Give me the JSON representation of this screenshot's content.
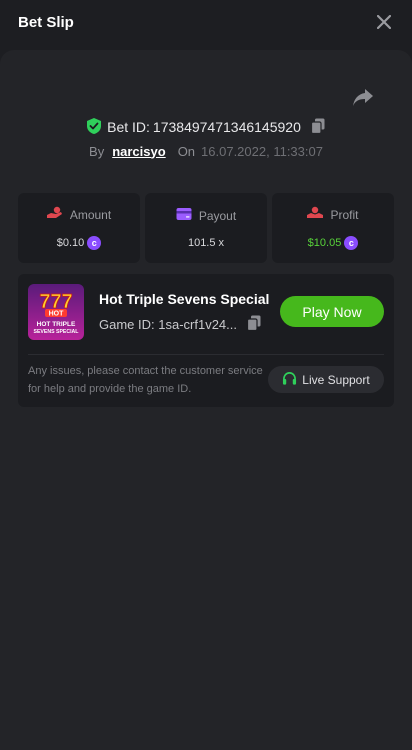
{
  "header": {
    "title": "Bet Slip",
    "close_icon": "close-icon"
  },
  "bet": {
    "id_label": "Bet ID:",
    "id_value": "1738497471346145920",
    "by_label": "By",
    "username": "narcisyo",
    "on_label": "On",
    "datetime": "16.07.2022, 11:33:07"
  },
  "stats": [
    {
      "label": "Amount",
      "value": "$0.10",
      "icon": "amount-hand-icon",
      "coin": "c"
    },
    {
      "label": "Payout",
      "value": "101.5 x",
      "icon": "payout-card-icon"
    },
    {
      "label": "Profit",
      "value": "$10.05",
      "icon": "profit-hand-icon",
      "coin": "c"
    }
  ],
  "game": {
    "title": "Hot Triple Sevens Special",
    "id_text": "Game ID: 1sa-crf1v24...",
    "play_label": "Play Now",
    "thumbnail": {
      "badge": "HOT",
      "line1": "HOT TRIPLE",
      "line2": "SEVENS SPECIAL"
    }
  },
  "support": {
    "text": "Any issues, please contact the customer service for help and provide the game ID.",
    "button_label": "Live Support"
  },
  "colors": {
    "background": "#1d1e22",
    "panel": "#232428",
    "card": "#1b1c20",
    "accent_green": "#46b81c",
    "profit_green": "#58d33a",
    "coin_purple": "#8a4dff",
    "shield_green": "#2fd05b"
  }
}
